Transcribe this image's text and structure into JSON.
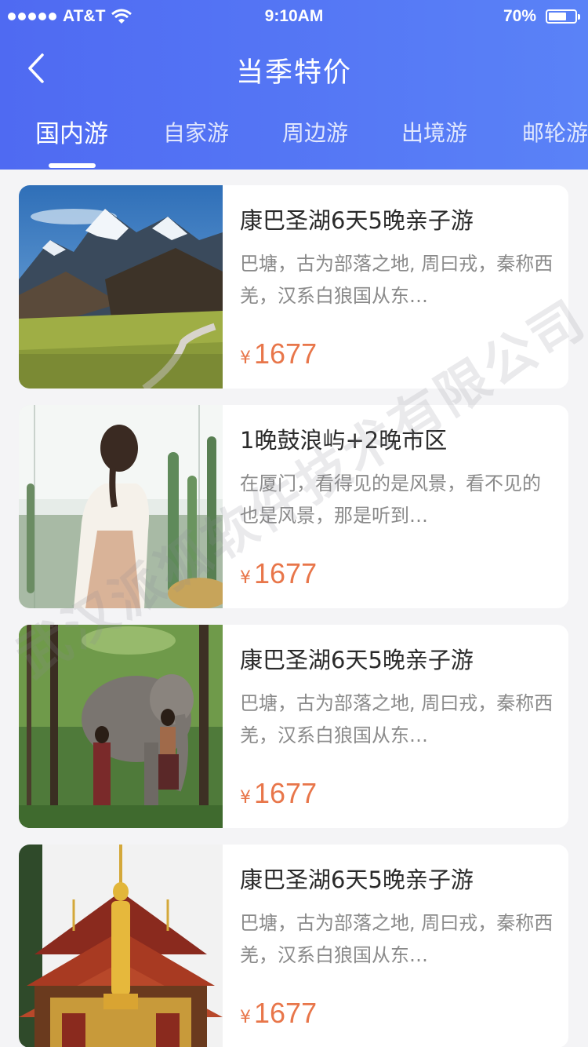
{
  "status_bar": {
    "carrier": "AT&T",
    "time": "9:10AM",
    "battery": "70%",
    "battery_level": 0.7
  },
  "header": {
    "title": "当季特价"
  },
  "tabs": [
    {
      "label": "国内游",
      "active": true
    },
    {
      "label": "自家游",
      "active": false
    },
    {
      "label": "周边游",
      "active": false
    },
    {
      "label": "出境游",
      "active": false
    },
    {
      "label": "邮轮游",
      "active": false
    }
  ],
  "products": [
    {
      "title": "康巴圣湖6天5晚亲子游",
      "description": "巴塘，古为部落之地, 周曰戎，秦称西羌，汉系白狼国从东…",
      "currency": "¥",
      "price": "1677",
      "image": "snow-mountain-valley"
    },
    {
      "title": "1晚鼓浪屿+2晚市区",
      "description": "在厦门，看得见的是风景，看不见的也是风景，那是听到…",
      "currency": "¥",
      "price": "1677",
      "image": "woman-cactus-garden"
    },
    {
      "title": "康巴圣湖6天5晚亲子游",
      "description": "巴塘，古为部落之地, 周曰戎，秦称西羌，汉系白狼国从东…",
      "currency": "¥",
      "price": "1677",
      "image": "elephant-forest"
    },
    {
      "title": "康巴圣湖6天5晚亲子游",
      "description": "巴塘，古为部落之地, 周曰戎，秦称西羌，汉系白狼国从东…",
      "currency": "¥",
      "price": "1677",
      "image": "golden-temple"
    }
  ],
  "watermark": "武汉派狐软件技术有限公司",
  "colors": {
    "header_start": "#4f6af2",
    "header_end": "#5a82f7",
    "price": "#e8764a",
    "background": "#f4f4f6"
  }
}
